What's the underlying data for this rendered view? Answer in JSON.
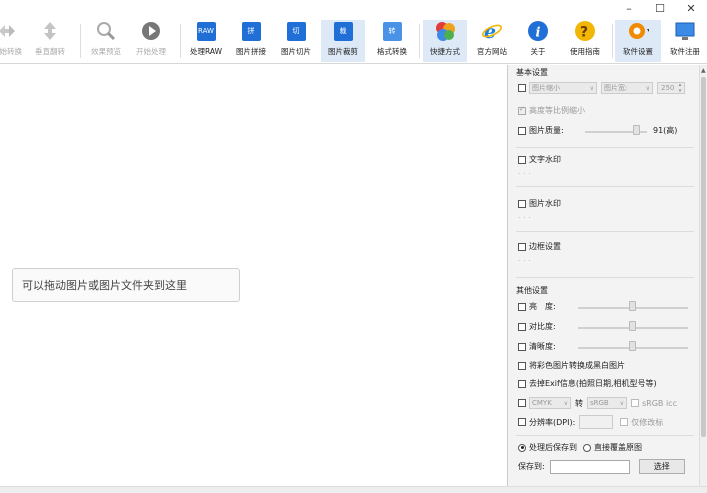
{
  "window": {
    "minimize": "–",
    "maximize": "☐",
    "close": "✕"
  },
  "toolbar": {
    "items": [
      {
        "label": "开始转换",
        "icon": "arrows-lr-icon",
        "disabled": true
      },
      {
        "label": "垂直翻转",
        "icon": "arrows-ud-icon",
        "disabled": true
      },
      {
        "label": "效果预览",
        "icon": "magnifier-icon",
        "disabled": true
      },
      {
        "label": "开始处理",
        "icon": "play-icon",
        "disabled": true
      },
      {
        "label": "处理RAW",
        "icon": "raw-icon",
        "badge": "RAW"
      },
      {
        "label": "图片拼接",
        "icon": "stitch-icon",
        "badge": "拼"
      },
      {
        "label": "图片切片",
        "icon": "slice-icon",
        "badge": "切"
      },
      {
        "label": "图片裁剪",
        "icon": "crop-icon",
        "badge": "裁"
      },
      {
        "label": "格式转换",
        "icon": "convert-icon",
        "badge": "转"
      },
      {
        "label": "快捷方式",
        "icon": "shortcut-icon"
      },
      {
        "label": "官方网站",
        "icon": "ie-icon"
      },
      {
        "label": "关于",
        "icon": "info-icon"
      },
      {
        "label": "使用指南",
        "icon": "help-icon"
      },
      {
        "label": "软件设置",
        "icon": "settings-icon"
      },
      {
        "label": "软件注册",
        "icon": "register-icon"
      }
    ]
  },
  "work": {
    "drop_hint": "可以拖动图片或图片文件夹到这里"
  },
  "panel": {
    "basic": {
      "title": "基本设置",
      "resize_label": "图片缩小",
      "resize_mode": "图片宽:",
      "resize_value": "250",
      "keep_ratio": "高度等比例缩小",
      "quality_label": "图片质量:",
      "quality_value": "91(高)"
    },
    "text_watermark": "文字水印",
    "image_watermark": "图片水印",
    "border": "边框设置",
    "other": {
      "title": "其他设置",
      "brightness": "亮　度:",
      "contrast": "对比度:",
      "saturation": "清晰度:",
      "grayscale": "将彩色图片转换成黑白图片",
      "remove_exif": "去掉Exif信息(拍照日期,相机型号等)",
      "cmyk_from": "CMYK",
      "cmyk_to_word": "转",
      "cmyk_to": "sRGB",
      "icc": "sRGB icc",
      "dpi_label": "分辨率(DPI):",
      "dpi_keep": "仅修改标"
    },
    "save": {
      "save_after": "处理后保存到",
      "overwrite": "直接覆盖原图",
      "save_to": "保存到:",
      "choose": "选择"
    }
  }
}
